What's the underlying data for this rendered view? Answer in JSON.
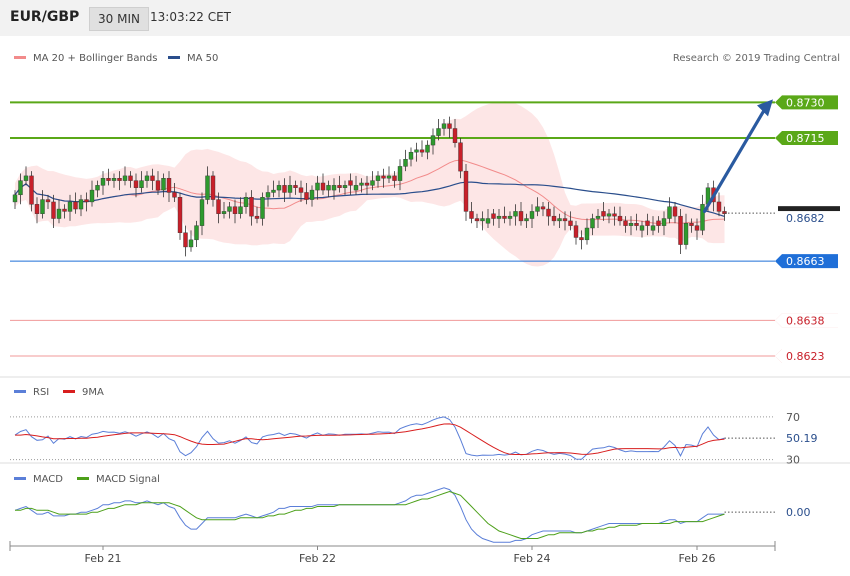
{
  "header": {
    "symbol": "EUR/GBP",
    "timeframe": "30 MIN",
    "time": "13:03:22 CET"
  },
  "attribution": "Research © 2019 Trading Central",
  "colors": {
    "up": "#2e9a2e",
    "down": "#c8202a",
    "ma20": "#f28b8b",
    "ma50": "#2a4e8c",
    "band": "#fde2e2",
    "green_level": "#5aa818",
    "blue_level": "#1f6fd8",
    "red_level": "#f09a9a",
    "rsi": "#5b7fd8",
    "rsi_ma": "#d81e1e",
    "macd": "#5b7fd8",
    "macd_signal": "#4da01a",
    "arrow": "#2a5aa0"
  },
  "chart_data": [
    {
      "type": "candlestick",
      "legend": [
        {
          "name": "MA 20 + Bollinger Bands"
        },
        {
          "name": "MA 50"
        }
      ],
      "ylim": [
        0.8612,
        0.8742
      ],
      "x_labels": [
        {
          "i": 16,
          "label": "Feb 21"
        },
        {
          "i": 55,
          "label": "Feb 22"
        },
        {
          "i": 94,
          "label": "Feb 24"
        },
        {
          "i": 124,
          "label": "Feb 26"
        }
      ],
      "levels": [
        {
          "value": 0.873,
          "label": "0.8730",
          "kind": "resistance2"
        },
        {
          "value": 0.8715,
          "label": "0.8715",
          "kind": "resistance1"
        },
        {
          "value": 0.8663,
          "label": "0.8663",
          "kind": "support1"
        },
        {
          "value": 0.8638,
          "label": "0.8638",
          "kind": "support2"
        },
        {
          "value": 0.8623,
          "label": "0.8623",
          "kind": "support3"
        }
      ],
      "last_price": {
        "value": 0.8682,
        "label": "0.8682"
      },
      "forecast": {
        "from_index": 125,
        "from_value": 0.8684,
        "to_value": 0.873
      },
      "closes": [
        0.8691,
        0.8697,
        0.8699,
        0.8687,
        0.8683,
        0.8689,
        0.8688,
        0.8681,
        0.8685,
        0.8684,
        0.8688,
        0.8685,
        0.8689,
        0.8688,
        0.8693,
        0.8695,
        0.8698,
        0.8697,
        0.8698,
        0.8697,
        0.8699,
        0.8697,
        0.8694,
        0.8697,
        0.8699,
        0.8697,
        0.8693,
        0.8698,
        0.8692,
        0.869,
        0.8675,
        0.8669,
        0.8672,
        0.8678,
        0.8689,
        0.8699,
        0.8689,
        0.8683,
        0.8684,
        0.8686,
        0.8683,
        0.8686,
        0.869,
        0.8682,
        0.8681,
        0.869,
        0.8692,
        0.8693,
        0.8695,
        0.8692,
        0.8695,
        0.8694,
        0.8692,
        0.8689,
        0.8693,
        0.8696,
        0.8693,
        0.8695,
        0.8695,
        0.8694,
        0.8695,
        0.8695,
        0.8695,
        0.8696,
        0.8695,
        0.8697,
        0.8699,
        0.8698,
        0.8699,
        0.8697,
        0.8703,
        0.8706,
        0.8709,
        0.871,
        0.8709,
        0.8712,
        0.8716,
        0.8719,
        0.8721,
        0.8719,
        0.8713,
        0.8701,
        0.8684,
        0.8681,
        0.868,
        0.8681,
        0.8681,
        0.8681,
        0.8682,
        0.8681,
        0.8682,
        0.8684,
        0.868,
        0.8681,
        0.8684,
        0.8686,
        0.8685,
        0.8682,
        0.868,
        0.8681,
        0.868,
        0.8678,
        0.8673,
        0.8672,
        0.8677,
        0.8681,
        0.8682,
        0.8682,
        0.8683,
        0.8682,
        0.868,
        0.8678,
        0.8679,
        0.8678,
        0.8678,
        0.8678,
        0.8678,
        0.8678,
        0.8681,
        0.8686,
        0.8682,
        0.867,
        0.8679,
        0.8678,
        0.8676,
        0.8687,
        0.8694,
        0.8688,
        0.8684,
        0.8683
      ]
    },
    {
      "type": "line",
      "title": "RSI",
      "legend": [
        {
          "name": "RSI"
        },
        {
          "name": "9MA"
        }
      ],
      "ylim": [
        24,
        84
      ],
      "ticks": [
        {
          "value": 70,
          "label": "70"
        },
        {
          "value": 30,
          "label": "30"
        }
      ],
      "last": {
        "value": 50.19,
        "label": "50.19"
      },
      "series": [
        {
          "name": "RSI",
          "values": [
            53.0,
            56.3,
            58.0,
            51.5,
            48.1,
            48.6,
            52.1,
            45.3,
            49.8,
            49.1,
            51.5,
            49.4,
            51.7,
            50.7,
            53.8,
            54.7,
            56.4,
            55.6,
            55.8,
            54.7,
            56.1,
            54.6,
            51.9,
            54.2,
            56.0,
            54.1,
            50.7,
            54.5,
            49.6,
            47.4,
            37.3,
            33.7,
            36.5,
            42.1,
            50.7,
            56.5,
            49.6,
            45.5,
            45.9,
            47.6,
            45.4,
            47.8,
            51.3,
            45.9,
            44.7,
            51.3,
            52.9,
            53.5,
            54.9,
            52.6,
            54.6,
            53.9,
            52.1,
            50.2,
            53.1,
            55.0,
            52.7,
            54.1,
            53.8,
            52.9,
            53.7,
            53.8,
            53.8,
            54.1,
            53.6,
            54.8,
            56.1,
            55.6,
            55.8,
            54.4,
            59.0,
            61.0,
            62.7,
            63.6,
            62.7,
            64.7,
            67.2,
            69.0,
            70.0,
            67.6,
            60.5,
            48.8,
            35.6,
            34.2,
            33.5,
            34.2,
            34.1,
            34.2,
            34.9,
            34.2,
            35.0,
            37.0,
            34.4,
            35.1,
            37.8,
            39.5,
            38.5,
            36.4,
            34.9,
            35.8,
            35.2,
            33.8,
            30.5,
            30.4,
            35.2,
            39.8,
            40.7,
            41.1,
            42.7,
            41.3,
            39.1,
            37.4,
            38.2,
            37.5,
            37.5,
            37.5,
            37.6,
            37.5,
            41.8,
            47.6,
            43.2,
            33.5,
            44.2,
            43.6,
            41.9,
            54.1,
            60.6,
            53.1,
            48.6,
            50.19
          ]
        },
        {
          "name": "9MA",
          "values": [
            53.0,
            53.0,
            53.5,
            53.0,
            52.2,
            51.3,
            50.6,
            49.6,
            49.6,
            49.7,
            49.8,
            49.8,
            50.0,
            50.0,
            50.6,
            51.0,
            51.8,
            52.6,
            53.3,
            53.9,
            54.6,
            55.0,
            55.0,
            55.0,
            54.9,
            54.7,
            54.5,
            54.3,
            53.9,
            53.3,
            51.6,
            49.4,
            47.3,
            45.6,
            44.5,
            44.2,
            44.2,
            44.3,
            44.5,
            45.8,
            47.2,
            48.5,
            49.7,
            49.5,
            48.9,
            48.6,
            48.9,
            49.5,
            50.0,
            50.5,
            51.0,
            51.6,
            52.0,
            52.1,
            52.5,
            52.7,
            52.8,
            52.9,
            52.9,
            53.0,
            53.1,
            53.2,
            53.4,
            53.5,
            53.7,
            53.8,
            54.0,
            54.2,
            54.5,
            54.9,
            55.5,
            56.2,
            57.0,
            57.9,
            58.8,
            59.8,
            61.0,
            62.3,
            63.4,
            63.5,
            62.6,
            60.4,
            57.2,
            54.0,
            50.8,
            47.6,
            44.4,
            41.5,
            38.8,
            36.5,
            35.0,
            34.8,
            34.8,
            34.9,
            35.3,
            35.6,
            36.1,
            36.5,
            36.5,
            36.6,
            36.5,
            36.2,
            35.6,
            35.1,
            34.9,
            35.4,
            36.2,
            37.4,
            38.6,
            39.8,
            40.2,
            40.3,
            40.3,
            40.3,
            40.3,
            40.3,
            40.2,
            40.0,
            40.2,
            41.1,
            41.4,
            41.0,
            41.5,
            42.0,
            42.5,
            44.5,
            46.8,
            48.0,
            48.7,
            49.2
          ]
        }
      ]
    },
    {
      "type": "line",
      "title": "MACD",
      "legend": [
        {
          "name": "MACD"
        },
        {
          "name": "MACD Signal"
        }
      ],
      "ylim": [
        -0.0018,
        0.0015
      ],
      "last": {
        "value": 0.0,
        "label": "0.00"
      },
      "series": [
        {
          "name": "MACD",
          "values": [
            0.0001,
            0.0002,
            0.0003,
            0.0001,
            -0.0001,
            -0.0001,
            0.0,
            -0.0002,
            -0.0002,
            -0.0002,
            -0.0001,
            -0.0001,
            0.0,
            0.0,
            0.0001,
            0.0002,
            0.0004,
            0.0004,
            0.0005,
            0.0005,
            0.0006,
            0.0006,
            0.0005,
            0.0005,
            0.0006,
            0.0005,
            0.0004,
            0.0005,
            0.0003,
            0.0002,
            -0.0003,
            -0.0007,
            -0.0009,
            -0.0009,
            -0.0006,
            -0.0003,
            -0.0003,
            -0.0003,
            -0.0003,
            -0.0003,
            -0.0003,
            -0.0002,
            -0.0001,
            -0.0002,
            -0.0003,
            -0.0002,
            -0.0001,
            0.0,
            0.0002,
            0.0002,
            0.0003,
            0.0003,
            0.0003,
            0.0003,
            0.0003,
            0.0004,
            0.0004,
            0.0004,
            0.0004,
            0.0004,
            0.0004,
            0.0004,
            0.0004,
            0.0004,
            0.0004,
            0.0004,
            0.0004,
            0.0004,
            0.0004,
            0.0004,
            0.0005,
            0.0006,
            0.0008,
            0.0009,
            0.0009,
            0.001,
            0.0011,
            0.0012,
            0.0013,
            0.0012,
            0.0009,
            0.0003,
            -0.0004,
            -0.0009,
            -0.0012,
            -0.0014,
            -0.0015,
            -0.0016,
            -0.0016,
            -0.0016,
            -0.0016,
            -0.0015,
            -0.0015,
            -0.0014,
            -0.0012,
            -0.0011,
            -0.001,
            -0.001,
            -0.001,
            -0.001,
            -0.001,
            -0.001,
            -0.0011,
            -0.0011,
            -0.001,
            -0.0009,
            -0.0008,
            -0.0007,
            -0.0006,
            -0.0006,
            -0.0006,
            -0.0006,
            -0.0006,
            -0.0006,
            -0.0006,
            -0.0006,
            -0.0006,
            -0.0006,
            -0.0005,
            -0.0004,
            -0.0004,
            -0.0006,
            -0.0005,
            -0.0005,
            -0.0005,
            -0.0003,
            -0.0001,
            -0.0001,
            -0.0001,
            -0.0001
          ]
        },
        {
          "name": "MACD Signal",
          "values": [
            0.0001,
            0.0001,
            0.0002,
            0.0002,
            0.0001,
            0.0001,
            0.0001,
            0.0,
            -0.0001,
            -0.0001,
            -0.0001,
            -0.0001,
            -0.0001,
            -0.0001,
            0.0,
            0.0,
            0.0001,
            0.0002,
            0.0002,
            0.0003,
            0.0004,
            0.0004,
            0.0004,
            0.0005,
            0.0005,
            0.0005,
            0.0005,
            0.0005,
            0.0005,
            0.0004,
            0.0003,
            0.0001,
            -0.0001,
            -0.0003,
            -0.0004,
            -0.0004,
            -0.0004,
            -0.0004,
            -0.0004,
            -0.0004,
            -0.0004,
            -0.0003,
            -0.0003,
            -0.0003,
            -0.0003,
            -0.0003,
            -0.0002,
            -0.0002,
            -0.0001,
            -0.0001,
            0.0,
            0.0001,
            0.0001,
            0.0002,
            0.0002,
            0.0003,
            0.0003,
            0.0003,
            0.0003,
            0.0004,
            0.0004,
            0.0004,
            0.0004,
            0.0004,
            0.0004,
            0.0004,
            0.0004,
            0.0004,
            0.0004,
            0.0004,
            0.0004,
            0.0004,
            0.0005,
            0.0006,
            0.0007,
            0.0007,
            0.0008,
            0.0009,
            0.001,
            0.0011,
            0.001,
            0.0009,
            0.0006,
            0.0003,
            0.0,
            -0.0003,
            -0.0006,
            -0.0008,
            -0.001,
            -0.0011,
            -0.0012,
            -0.0013,
            -0.0014,
            -0.0014,
            -0.0014,
            -0.0014,
            -0.0013,
            -0.0012,
            -0.0012,
            -0.0011,
            -0.0011,
            -0.0011,
            -0.0011,
            -0.0011,
            -0.001,
            -0.001,
            -0.0009,
            -0.0009,
            -0.0008,
            -0.0008,
            -0.0007,
            -0.0007,
            -0.0007,
            -0.0007,
            -0.0006,
            -0.0006,
            -0.0006,
            -0.0006,
            -0.0006,
            -0.0006,
            -0.0005,
            -0.0005,
            -0.0005,
            -0.0005,
            -0.0005,
            -0.0005,
            -0.0004,
            -0.0003,
            -0.0002,
            -0.0001
          ]
        }
      ]
    }
  ]
}
